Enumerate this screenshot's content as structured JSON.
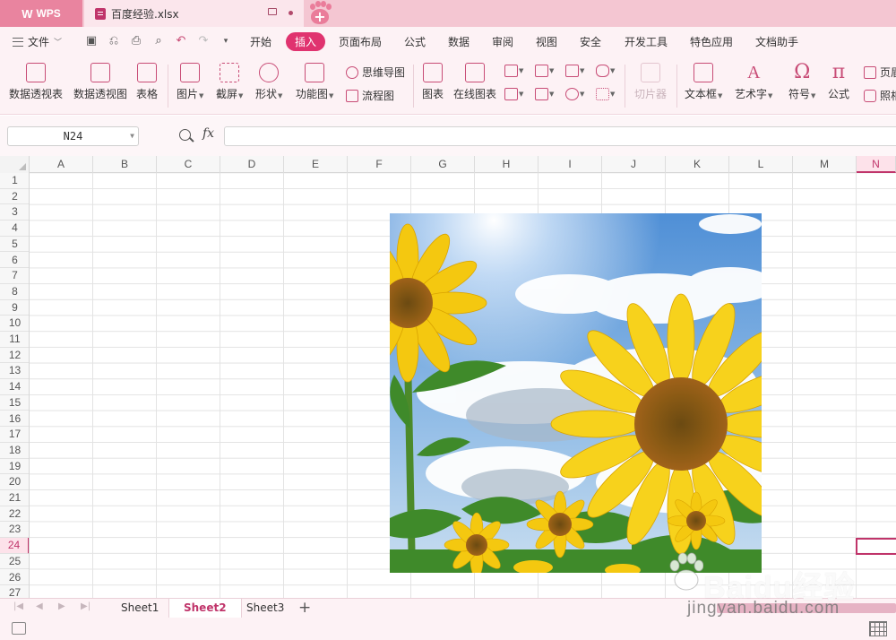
{
  "titlebar": {
    "app_tab": "WPS",
    "doc_tab": "百度经验.xlsx"
  },
  "menubar": {
    "file": "文件",
    "tabs": [
      "开始",
      "插入",
      "页面布局",
      "公式",
      "数据",
      "审阅",
      "视图",
      "安全",
      "开发工具",
      "特色应用",
      "文档助手"
    ],
    "active_tab": "插入"
  },
  "ribbon": {
    "pivot_table": "数据透视表",
    "pivot_chart": "数据透视图",
    "table": "表格",
    "picture": "图片",
    "screenshot": "截屏",
    "shapes": "形状",
    "function_chart": "功能图",
    "mind_map": "思维导图",
    "flowchart": "流程图",
    "chart": "图表",
    "online_chart": "在线图表",
    "slicer": "切片器",
    "textbox": "文本框",
    "wordart": "艺术字",
    "symbol": "符号",
    "equation": "公式",
    "page_partial_1": "页眉",
    "page_partial_2": "照相"
  },
  "formula": {
    "namebox": "N24",
    "fx": "fx",
    "value": ""
  },
  "grid": {
    "columns": [
      "A",
      "B",
      "C",
      "D",
      "E",
      "F",
      "G",
      "H",
      "I",
      "J",
      "K",
      "L",
      "M",
      "N"
    ],
    "rows": [
      "1",
      "2",
      "3",
      "4",
      "5",
      "6",
      "7",
      "8",
      "9",
      "10",
      "11",
      "12",
      "13",
      "14",
      "15",
      "16",
      "17",
      "18",
      "19",
      "20",
      "21",
      "22",
      "23",
      "24",
      "25",
      "26",
      "27"
    ],
    "active_column": "N",
    "active_row": "24"
  },
  "sheets": {
    "tabs": [
      "Sheet1",
      "Sheet2",
      "Sheet3"
    ],
    "active": "Sheet2",
    "add": "+"
  },
  "watermark": {
    "brand": "Baidu经验",
    "url": "jingyan.baidu.com"
  },
  "colors": {
    "accent": "#e0336f",
    "titlebar": "#f4c6d2",
    "ribbon_bg": "#fdf2f5"
  }
}
